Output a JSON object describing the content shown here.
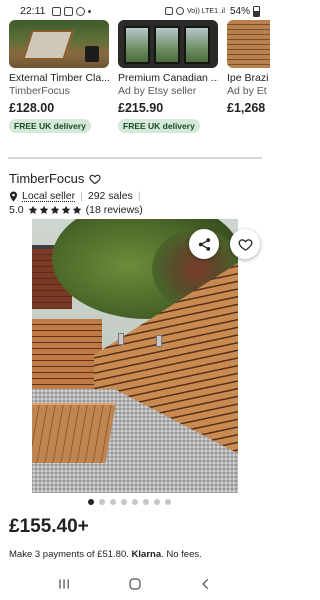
{
  "status_bar": {
    "time": "22:11",
    "network": "Vo)) LTE1 .il",
    "battery": "54%"
  },
  "related": [
    {
      "title": "External Timber Cla...",
      "shop": "TimberFocus",
      "price": "£128.00",
      "badge": "FREE UK delivery"
    },
    {
      "title": "Premium Canadian ...",
      "shop": "Ad by Etsy seller",
      "price": "£215.90",
      "badge": "FREE UK delivery"
    },
    {
      "title": "Ipe Brazi",
      "shop": "Ad by Et",
      "price": "£1,268",
      "badge": ""
    }
  ],
  "shop": {
    "name": "TimberFocus",
    "local_seller": "Local seller",
    "sales": "292 sales",
    "rating": "5.0",
    "stars": 5,
    "reviews": "(18 reviews)"
  },
  "gallery": {
    "total": 8,
    "current": 1
  },
  "listing": {
    "price": "£155.40+",
    "klarna_prefix": "Make 3 payments of £51.80.",
    "klarna_brand": "Klarna",
    "klarna_suffix": ". No fees."
  },
  "icons": {
    "share": "share-icon",
    "favorite": "heart-icon",
    "nav_recents": "recents-icon",
    "nav_home": "home-icon",
    "nav_back": "back-icon"
  },
  "colors": {
    "badge_bg": "#d4e9d7",
    "badge_text": "#1b4a27",
    "text": "#222222"
  }
}
